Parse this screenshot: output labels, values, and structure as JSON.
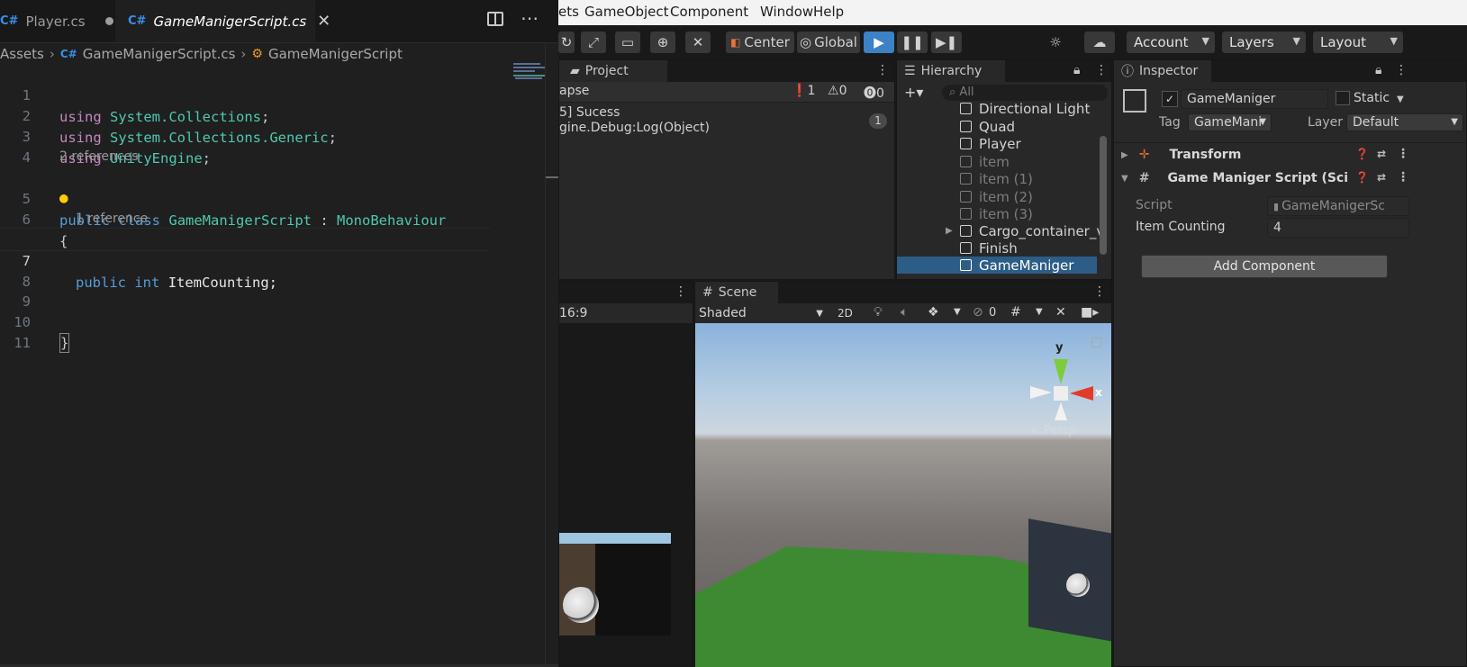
{
  "vscode": {
    "tabs": [
      {
        "label": "Player.cs",
        "modified": true
      },
      {
        "label": "GameManigerScript.cs",
        "active": true
      }
    ],
    "breadcrumb": [
      "Assets",
      "GameManigerScript.cs",
      "GameManigerScript"
    ],
    "line_numbers": [
      "1",
      "2",
      "3",
      "4",
      "5",
      "6",
      "7",
      "8",
      "9",
      "10",
      "11"
    ],
    "code": {
      "l1_kw": "using",
      "l1_ns": "System.Collections",
      "l1_end": ";",
      "l2_kw": "using",
      "l2_ns": "System.Collections.Generic",
      "l2_end": ";",
      "l3_kw": "using",
      "l3_ns": "UnityEngine",
      "l3_end": ";",
      "lens1": "2 references",
      "l5_public": "public",
      "l5_class": "class",
      "l5_name": "GameManigerScript",
      "l5_colon": " : ",
      "l5_base": "MonoBehaviour",
      "l6": "{",
      "lens2": "1 reference",
      "l7_public": "public",
      "l7_int": "int",
      "l7_field": "ItemCounting;",
      "l10": "}"
    }
  },
  "unity": {
    "menu": [
      "ets",
      "GameObject",
      "Component",
      "Window",
      "Help"
    ],
    "toolbar": {
      "pivot": "Center",
      "space": "Global",
      "account": "Account",
      "layers": "Layers",
      "layout": "Layout"
    },
    "project_tab": "Project",
    "console": {
      "collapse": "apse",
      "counts": {
        "info": "1",
        "warn": "0",
        "error": "0"
      },
      "message_line1": "5] Sucess",
      "message_line2": "gine.Debug:Log(Object)",
      "message_count": "1"
    },
    "hierarchy": {
      "tab": "Hierarchy",
      "search_placeholder": "All",
      "items": [
        {
          "label": "Directional Light",
          "active": true
        },
        {
          "label": "Quad",
          "active": true
        },
        {
          "label": "Player",
          "active": true
        },
        {
          "label": "item",
          "active": false
        },
        {
          "label": "item (1)",
          "active": false
        },
        {
          "label": "item (2)",
          "active": false
        },
        {
          "label": "item (3)",
          "active": false
        },
        {
          "label": "Cargo_container_v",
          "active": true,
          "expandable": true
        },
        {
          "label": "Finish",
          "active": true
        },
        {
          "label": "GameManiger",
          "active": true,
          "selected": true
        }
      ]
    },
    "inspector": {
      "tab": "Inspector",
      "object_name": "GameManiger",
      "static_label": "Static",
      "tag_label": "Tag",
      "tag_value": "GameMani",
      "layer_label": "Layer",
      "layer_value": "Default",
      "transform": "Transform",
      "script_component": "Game Maniger Script (Sci",
      "script_label": "Script",
      "script_value": "GameManigerSc",
      "item_counting_label": "Item Counting",
      "item_counting_value": "4",
      "add_component": "Add Component"
    },
    "game_view": {
      "aspect": "16:9"
    },
    "scene": {
      "tab": "Scene",
      "draw_mode": "Shaded",
      "mode_2d": "2D",
      "hidden_count": "0",
      "gizmo_y": "y",
      "gizmo_x": "x",
      "persp": "< Persp"
    }
  }
}
